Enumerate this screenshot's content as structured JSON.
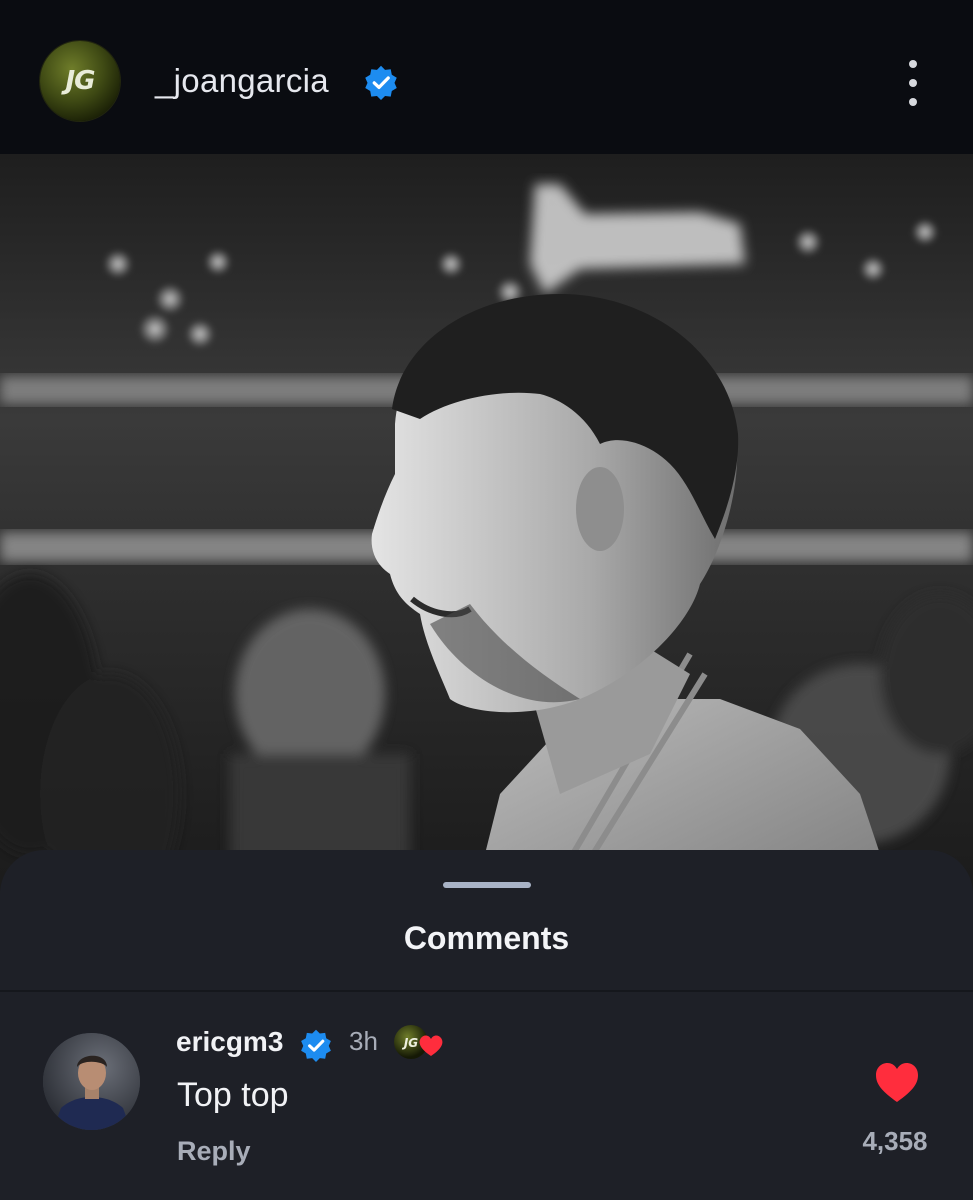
{
  "post": {
    "author": "_joangarcia",
    "author_avatar_monogram": "JG",
    "author_verified": true,
    "more_icon": "more-vertical-icon"
  },
  "comments_sheet": {
    "title": "Comments"
  },
  "comments": [
    {
      "username": "ericgm3",
      "verified": true,
      "time": "3h",
      "liked_by_author_badge": "author-avatar-with-heart",
      "text": "Top top",
      "reply_label": "Reply",
      "like_icon": "heart-filled-icon",
      "like_count": "4,358"
    }
  ],
  "colors": {
    "verified_blue": "#1d8cf0",
    "heart_red": "#ff2d3d",
    "sheet_bg": "#1e2027",
    "header_bg": "#0a0c11"
  }
}
